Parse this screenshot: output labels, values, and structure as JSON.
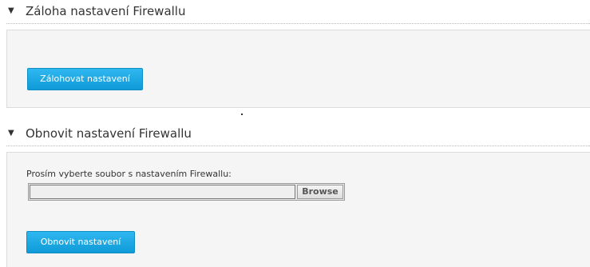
{
  "backup_section": {
    "toggle_glyph": "▼",
    "title": "Záloha nastavení Firewallu",
    "button_label": "Zálohovat nastavení"
  },
  "restore_section": {
    "toggle_glyph": "▼",
    "title": "Obnovit nastavení Firewallu",
    "file_prompt": "Prosím vyberte soubor s nastavením Firewallu:",
    "file_path_value": "",
    "browse_label": "Browse",
    "button_label": "Obnovit nastavení"
  },
  "colors": {
    "accent": "#1aa8e6",
    "panel_bg": "#f5f5f5",
    "text": "#333333"
  }
}
